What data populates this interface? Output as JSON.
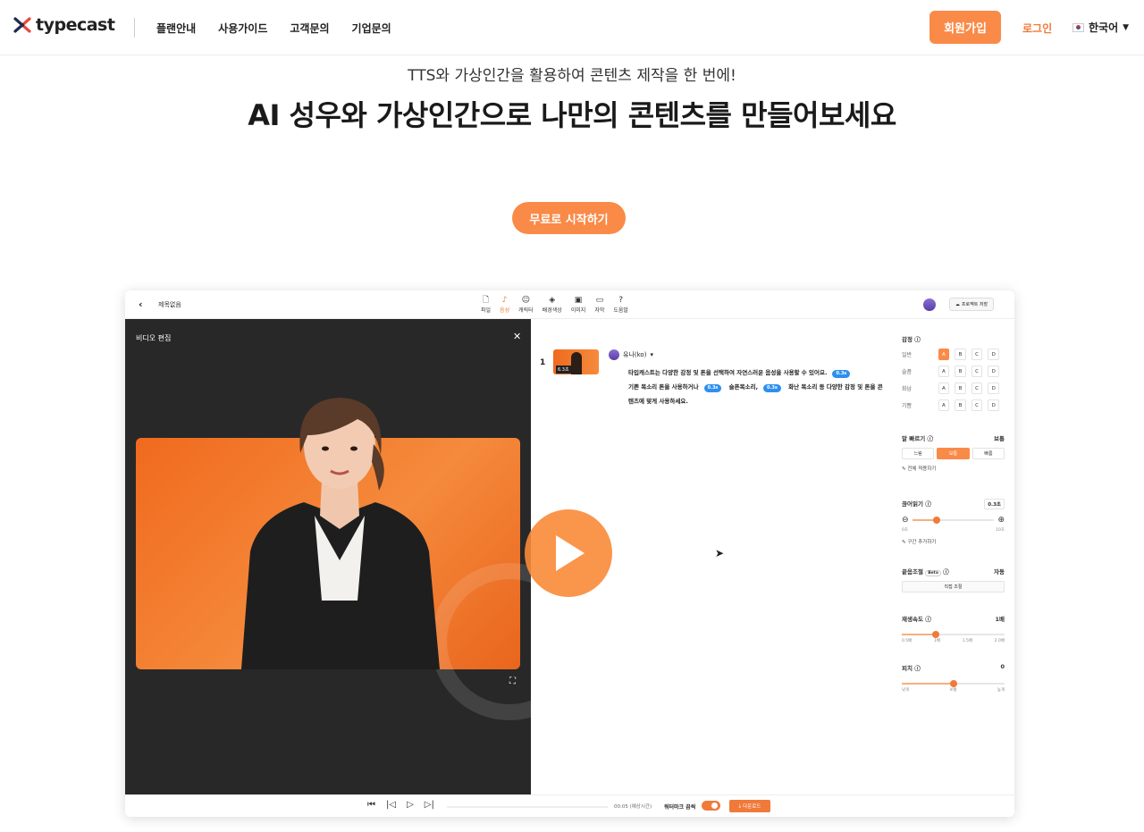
{
  "header": {
    "logo_text": "typecast",
    "nav": [
      "플랜안내",
      "사용가이드",
      "고객문의",
      "기업문의"
    ],
    "signup_label": "회원가입",
    "login_label": "로그인",
    "language_label": "한국어"
  },
  "hero": {
    "subtitle": "TTS와 가상인간을 활용하여 콘텐츠 제작을 한 번에!",
    "title": "AI 성우와 가상인간으로 나만의 콘텐츠를 만들어보세요",
    "cta_label": "무료로 시작하기"
  },
  "app": {
    "project_title": "제목없음",
    "toolbar": [
      {
        "label": "파일",
        "icon": "file-icon"
      },
      {
        "label": "음성",
        "icon": "voice-icon",
        "active": true
      },
      {
        "label": "캐릭터",
        "icon": "character-icon"
      },
      {
        "label": "배경색상",
        "icon": "paint-icon"
      },
      {
        "label": "이미지",
        "icon": "image-icon"
      },
      {
        "label": "자막",
        "icon": "caption-icon"
      },
      {
        "label": "도움말",
        "icon": "help-icon"
      }
    ],
    "save_label": "프로젝트 저장",
    "video_panel_title": "비디오 편집",
    "script": {
      "line_number": "1",
      "thumb_badge": "6.3초",
      "speaker": "유나(ko)",
      "segments": [
        {
          "text": "타입캐스트는 다양한 감정 및 톤을 선택하여 자연스러운 음성을 사용할 수 있어요.",
          "pause": "0.3s"
        },
        {
          "text": "기쁜 목소리 톤을 사용하거나",
          "pause": "0.3s"
        },
        {
          "text": "슬픈목소리,",
          "pause": "0.3s"
        },
        {
          "text": "화난 목소리 등 다양한 감정 및 톤을 콘텐츠에 맞게 사용하세요.",
          "pause": ""
        }
      ]
    },
    "right_panel": {
      "emotion_label": "감정",
      "emotions": [
        {
          "label": "일반",
          "selected": "A"
        },
        {
          "label": "슬픔",
          "selected": ""
        },
        {
          "label": "화남",
          "selected": ""
        },
        {
          "label": "기쁨",
          "selected": ""
        }
      ],
      "emotion_options": [
        "A",
        "B",
        "C",
        "D"
      ],
      "speed_label": "말 빠르기",
      "speed_value": "보통",
      "speed_options": [
        "느림",
        "보통",
        "빠름"
      ],
      "speed_selected": "보통",
      "apply_all_label": "전체 적용하기",
      "pause_label": "끊어읽기",
      "pause_value": "0.3초",
      "pause_fraction": 0.3,
      "pause_ticks": [
        "0초",
        "10초"
      ],
      "add_section_label": "구간 추가하기",
      "end_adjust_label": "끝음조절",
      "end_adjust_badge": "Beta",
      "end_adjust_value": "자동",
      "manual_adjust_label": "직접 조절",
      "play_speed_label": "재생속도",
      "play_speed_value": "1배",
      "play_speed_fraction": 0.33,
      "play_speed_ticks": [
        "0.5배",
        "1배",
        "1.5배",
        "2.0배"
      ],
      "pitch_label": "피치",
      "pitch_value": "0",
      "pitch_fraction": 0.5,
      "pitch_ticks": [
        "낮게",
        "보통",
        "높게"
      ]
    },
    "bottom_bar": {
      "time": "00:05 (예상시간)",
      "watermark_label": "워터마크 끔씩",
      "download_label": "다운로드"
    }
  },
  "colors": {
    "accent": "#fa8a48",
    "pause_badge": "#2d8ff0",
    "video_bg": "#282828"
  }
}
